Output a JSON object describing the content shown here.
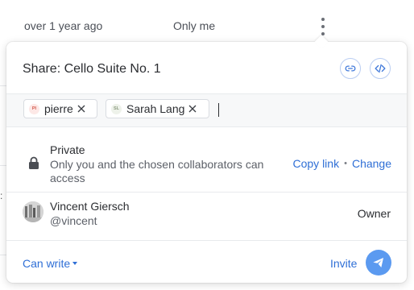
{
  "background_row": {
    "updated": "over 1 year ago",
    "access": "Only me"
  },
  "popover": {
    "title": "Share: Cello Suite No. 1",
    "recipients": [
      {
        "initials": "PI",
        "name": "pierre"
      },
      {
        "initials": "SL",
        "name": "Sarah Lang"
      }
    ],
    "privacy": {
      "title": "Private",
      "description": "Only you and the chosen collaborators can access",
      "copy_link": "Copy link",
      "separator": "•",
      "change": "Change"
    },
    "owner": {
      "name": "Vincent Giersch",
      "handle": "@vincent",
      "role": "Owner"
    },
    "footer": {
      "permission": "Can write",
      "invite": "Invite"
    }
  },
  "colors": {
    "accent": "#2f6fd6",
    "invite_button": "#5b9af0"
  },
  "icons": [
    "more-vertical-icon",
    "link-icon",
    "code-icon",
    "close-icon",
    "lock-icon",
    "caret-down-icon",
    "send-icon"
  ]
}
